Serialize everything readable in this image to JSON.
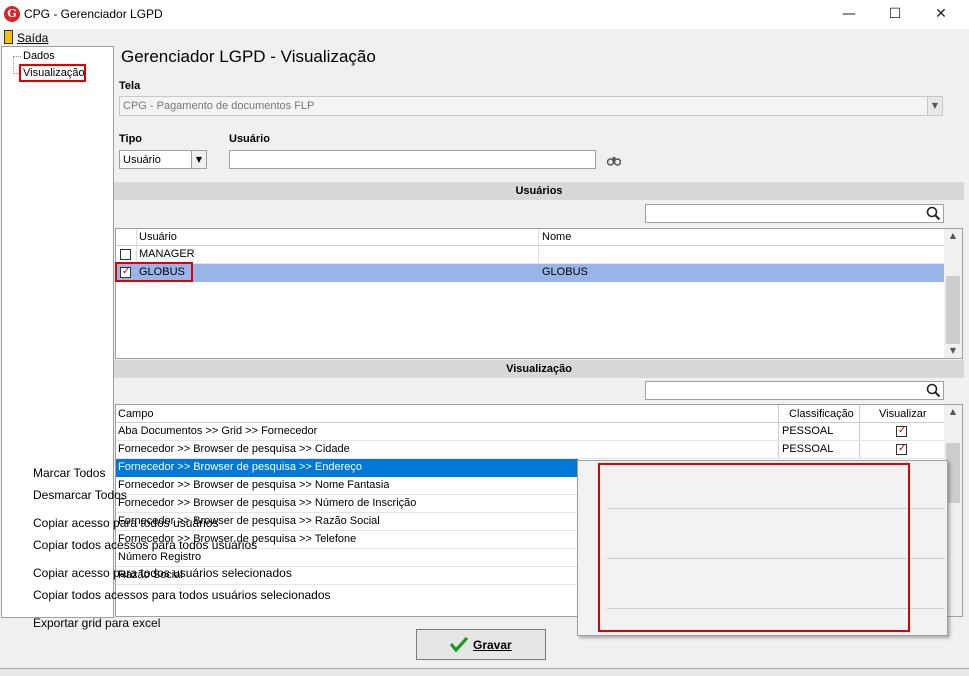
{
  "window": {
    "title": "CPG - Gerenciador LGPD",
    "minimize": "—",
    "maximize": "☐",
    "close": "✕"
  },
  "menu": {
    "exit_label": "Saída"
  },
  "tree": {
    "items": [
      "Dados",
      "Visualização"
    ]
  },
  "page": {
    "title": "Gerenciador LGPD - Visualização"
  },
  "screen": {
    "label": "Tela",
    "value": "CPG - Pagamento de documentos FLP"
  },
  "type": {
    "label": "Tipo",
    "value": "Usuário"
  },
  "user": {
    "label": "Usuário",
    "value": ""
  },
  "users_section": {
    "title": "Usuários",
    "search_value": "",
    "columns": [
      "Usuário",
      "Nome"
    ],
    "rows": [
      {
        "user": "MANAGER",
        "name": "",
        "checked": false
      },
      {
        "user": "GLOBUS",
        "name": "GLOBUS",
        "checked": true
      }
    ]
  },
  "view_section": {
    "title": "Visualização",
    "search_value": "",
    "columns": [
      "Campo",
      "Classificação",
      "Visualizar"
    ],
    "rows": [
      {
        "field": "Aba Documentos >> Grid >> Fornecedor",
        "class": "PESSOAL",
        "view": true
      },
      {
        "field": "Fornecedor >> Browser de pesquisa >> Cidade",
        "class": "PESSOAL",
        "view": true
      },
      {
        "field": "Fornecedor >> Browser de pesquisa >> Endereço",
        "class": "",
        "view": false
      },
      {
        "field": "Fornecedor >> Browser de pesquisa >> Nome Fantasia",
        "class": "",
        "view": false
      },
      {
        "field": "Fornecedor >> Browser de pesquisa >> Número de Inscrição",
        "class": "",
        "view": false
      },
      {
        "field": "Fornecedor >> Browser de pesquisa >> Razão Social",
        "class": "",
        "view": false
      },
      {
        "field": "Fornecedor >> Browser de pesquisa >> Telefone",
        "class": "",
        "view": false
      },
      {
        "field": "Número Registro",
        "class": "",
        "view": false
      },
      {
        "field": "Razão Social",
        "class": "",
        "view": false
      }
    ]
  },
  "context_menu": {
    "items": [
      "Marcar Todos",
      "Desmarcar Todos",
      "Copiar acesso para todos usuários",
      "Copiar todos acessos para todos usuários",
      "Copiar acesso para todos usuários selecionados",
      "Copiar todos acessos para todos usuários selecionados",
      "Exportar grid para excel"
    ]
  },
  "save_button": {
    "label": "Gravar"
  },
  "colors": {
    "selection": "#99b4e8",
    "highlight": "#0078d7",
    "annotation": "#e00000",
    "check": "#c00000"
  }
}
